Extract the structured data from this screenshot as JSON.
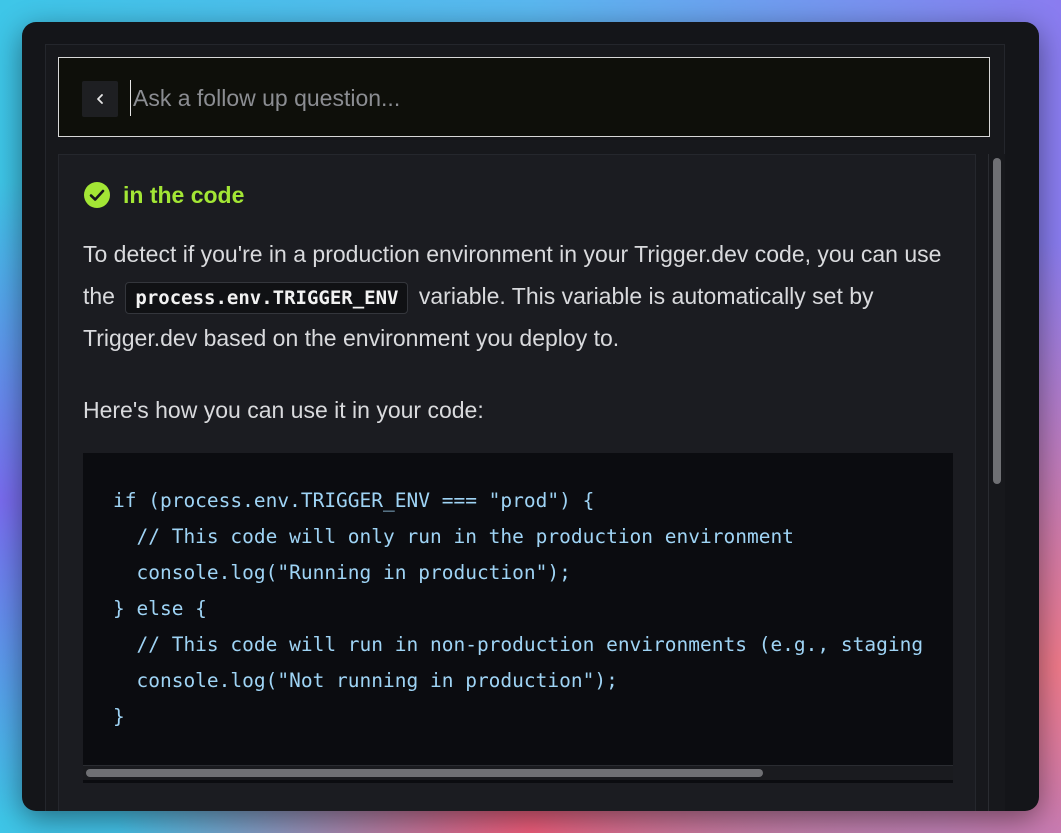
{
  "search": {
    "placeholder": "Ask a follow up question..."
  },
  "answer": {
    "heading": "in the code",
    "paragraph1_before": "To detect if you're in a production environment in your Trigger.dev code, you can use the ",
    "inline_code": "process.env.TRIGGER_ENV",
    "paragraph1_after": " variable. This variable is automatically set by Trigger.dev based on the environment you deploy to.",
    "paragraph2": "Here's how you can use it in your code:",
    "code_lines": [
      "if (process.env.TRIGGER_ENV === \"prod\") {",
      "  // This code will only run in the production environment",
      "  console.log(\"Running in production\");",
      "} else {",
      "  // This code will run in non-production environments (e.g., staging",
      "  console.log(\"Not running in production\");",
      "}"
    ]
  },
  "icons": {
    "back": "chevron-left-icon",
    "check": "check-circle-icon"
  },
  "colors": {
    "accent": "#a3e635",
    "code_text": "#9fd4f5",
    "background": "#141519"
  }
}
